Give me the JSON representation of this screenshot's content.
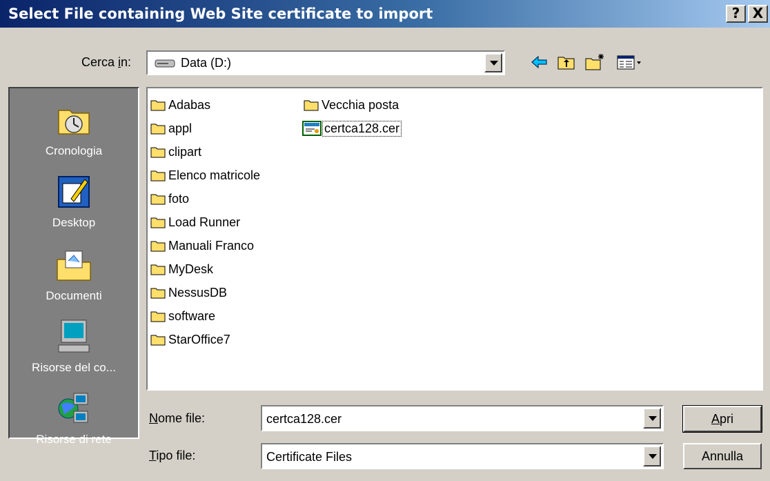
{
  "window": {
    "title": "Select File containing Web Site certificate to import",
    "help_label": "?",
    "close_label": "X"
  },
  "lookin": {
    "label_pre": "Cerca ",
    "label_u": "i",
    "label_post": "n:",
    "value": "Data (D:)"
  },
  "places": [
    {
      "label": "Cronologia",
      "icon": "history-icon"
    },
    {
      "label": "Desktop",
      "icon": "desktop-icon"
    },
    {
      "label": "Documenti",
      "icon": "documents-icon"
    },
    {
      "label": "Risorse del co...",
      "icon": "my-computer-icon"
    },
    {
      "label": "Risorse di rete",
      "icon": "network-icon"
    }
  ],
  "files": {
    "col1": [
      "Adabas",
      "appl",
      "clipart",
      "Elenco matricole",
      "foto",
      "Load Runner",
      "Manuali Franco",
      "MyDesk",
      "NessusDB",
      "software",
      "StarOffice7"
    ],
    "col2": [
      {
        "name": "Vecchia posta",
        "type": "folder"
      },
      {
        "name": "certca128.cer",
        "type": "certificate",
        "selected": true
      }
    ]
  },
  "filename": {
    "label_u": "N",
    "label_post": "ome file:",
    "value": "certca128.cer"
  },
  "filetype": {
    "label_u": "T",
    "label_post": "ipo file:",
    "value": "Certificate Files"
  },
  "buttons": {
    "open_u": "A",
    "open_post": "pri",
    "cancel": "Annulla"
  },
  "colors": {
    "title_start": "#0a246a",
    "title_end": "#a6caf0",
    "face": "#d4d0c8",
    "places_bg": "#808080",
    "folder": "#ffdf6b"
  }
}
